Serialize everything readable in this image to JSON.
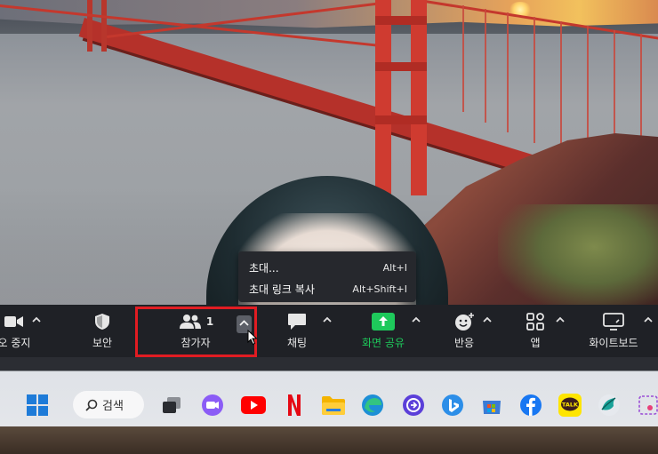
{
  "tooltip": {
    "items": [
      {
        "label": "초대...",
        "shortcut": "Alt+I"
      },
      {
        "label": "초대 링크 복사",
        "shortcut": "Alt+Shift+I"
      }
    ]
  },
  "toolbar": {
    "video_label": "오 중지",
    "security_label": "보안",
    "participants_label": "참가자",
    "participants_count": "1",
    "chat_label": "채팅",
    "share_label": "화면 공유",
    "reactions_label": "반응",
    "apps_label": "앱",
    "whiteboard_label": "화이트보드"
  },
  "taskbar": {
    "search_label": "검색",
    "kakao_label": "TALK"
  },
  "colors": {
    "highlight": "#e11c22",
    "share_green": "#1ec95b",
    "toolbar_bg": "#1f2126"
  }
}
